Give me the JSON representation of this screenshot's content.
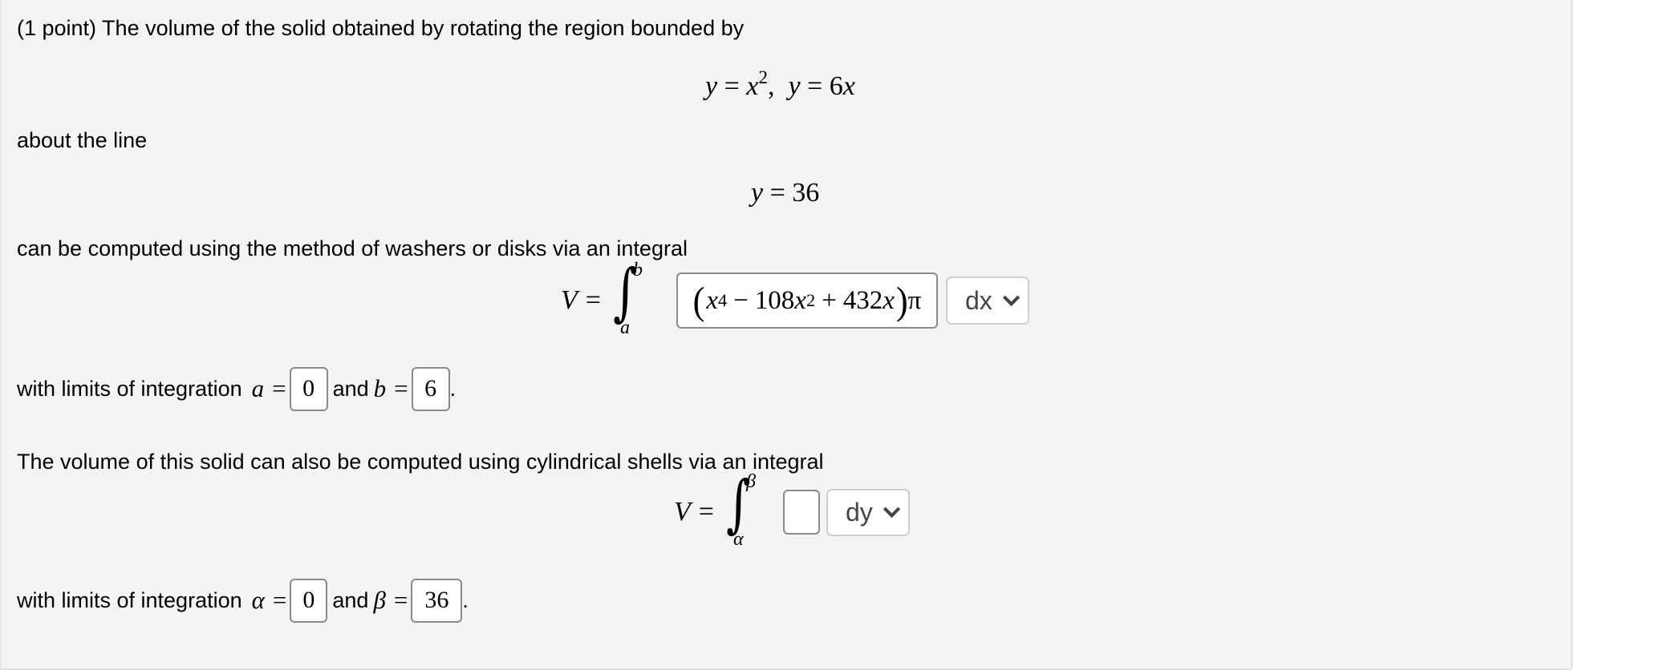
{
  "problem": {
    "intro": "(1 point) The volume of the solid obtained by rotating the region bounded by",
    "curves": {
      "first": {
        "lhs": "y",
        "eq": "=",
        "base": "x",
        "exp": "2"
      },
      "separator": ",",
      "second": {
        "lhs": "y",
        "eq": "=",
        "rhs_num": "6",
        "rhs_var": "x"
      }
    },
    "about_text": "about the line",
    "axis_line": {
      "lhs": "y",
      "eq": "=",
      "rhs": "36"
    },
    "washers_text": "can be computed using the method of washers or disks via an integral",
    "washers_integral": {
      "lhs": "V",
      "eq": "=",
      "upper": "b",
      "lower": "a",
      "integrand_answer": {
        "open": "(",
        "t1_base": "x",
        "t1_exp": "4",
        "op1": "−",
        "t2_coef": "108",
        "t2_base": "x",
        "t2_exp": "2",
        "op2": "+",
        "t3": "432",
        "t3_var": "x",
        "close": ")",
        "factor": "π"
      },
      "differential_select": {
        "selected": "dx"
      }
    },
    "washers_limits": {
      "prefix": "with limits of integration",
      "var_a": "a",
      "eq": "=",
      "a_value": "0",
      "and": "and",
      "var_b": "b",
      "b_value": "6",
      "end": "."
    },
    "shells_text": "The volume of this solid can also be computed using cylindrical shells via an integral",
    "shells_integral": {
      "lhs": "V",
      "eq": "=",
      "upper": "β",
      "lower": "α",
      "integrand_answer": "",
      "differential_select": {
        "selected": "dy"
      }
    },
    "shells_limits": {
      "prefix": "with limits of integration",
      "var_a": "α",
      "eq": "=",
      "a_value": "0",
      "and": "and",
      "var_b": "β",
      "b_value": "36",
      "end": "."
    }
  }
}
